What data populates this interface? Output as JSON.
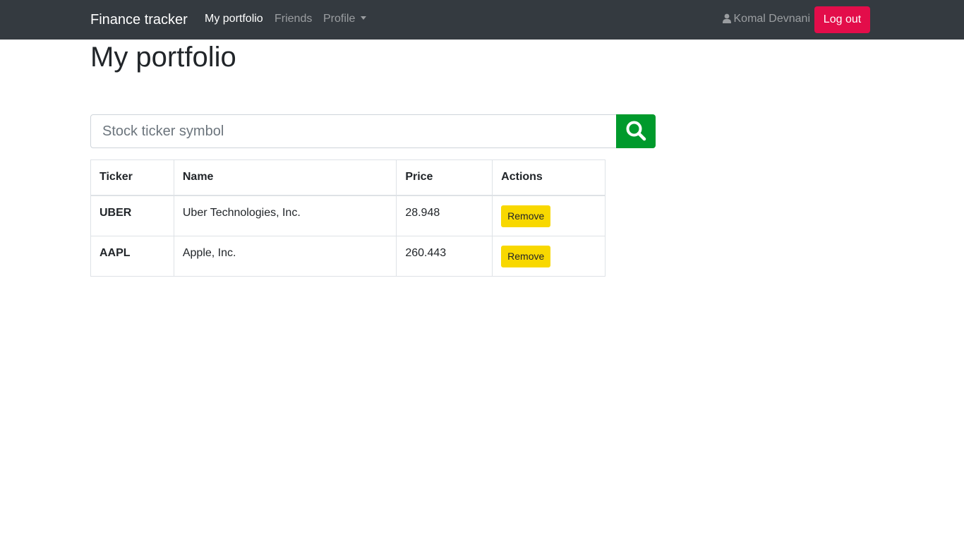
{
  "navbar": {
    "brand": "Finance tracker",
    "links": [
      {
        "label": "My portfolio",
        "active": true
      },
      {
        "label": "Friends",
        "active": false
      },
      {
        "label": "Profile",
        "active": false
      }
    ],
    "user_icon": "user-icon",
    "user_name": "Komal Devnani",
    "logout_label": "Log out"
  },
  "page": {
    "title": "My portfolio"
  },
  "search": {
    "placeholder": "Stock ticker symbol",
    "value": "",
    "button_icon": "search-icon"
  },
  "table": {
    "headers": [
      "Ticker",
      "Name",
      "Price",
      "Actions"
    ],
    "rows": [
      {
        "ticker": "UBER",
        "name": "Uber Technologies, Inc.",
        "price": "28.948",
        "action": "Remove"
      },
      {
        "ticker": "AAPL",
        "name": "Apple, Inc.",
        "price": "260.443",
        "action": "Remove"
      }
    ]
  },
  "colors": {
    "navbar_bg": "#343a40",
    "logout": "#e30d4a",
    "search_button": "#009a2c",
    "remove_button": "#f8d800"
  }
}
